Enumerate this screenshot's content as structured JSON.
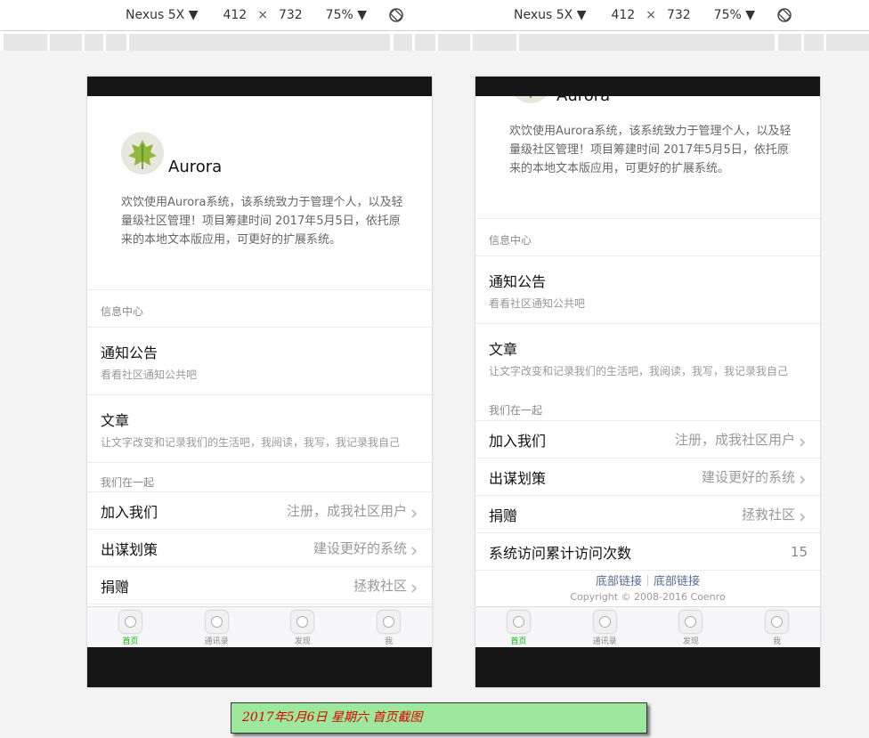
{
  "devtools": {
    "left": {
      "device": "Nexus 5X ▼",
      "width": "412",
      "times": "×",
      "height": "732",
      "zoom": "75% ▼"
    },
    "right": {
      "device": "Nexus 5X ▼",
      "width": "412",
      "times": "×",
      "height": "732",
      "zoom": "75% ▼"
    }
  },
  "app": {
    "name": "Aurora",
    "intro": "欢饮使用Aurora系统，该系统致力于管理个人，以及轻量级社区管理！项目筹建时间 2017年5月5日，依托原来的本地文本版应用，可更好的扩展系统。",
    "section1_title": "信息中心",
    "news": [
      {
        "title": "通知公告",
        "desc": "看看社区通知公共吧"
      },
      {
        "title": "文章",
        "desc": "让文字改变和记录我们的生活吧，我阅读，我写，我记录我自己"
      }
    ],
    "section2_title": "我们在一起",
    "cells": [
      {
        "label": "加入我们",
        "value": "注册，成我社区用户"
      },
      {
        "label": "出谋划策",
        "value": "建设更好的系统"
      },
      {
        "label": "捐赠",
        "value": "拯救社区"
      }
    ],
    "visits": {
      "label": "系统访问累计访问次数",
      "value": "15"
    },
    "footer": {
      "link1": "底部链接",
      "link2": "底部链接",
      "copyright": "Copyright © 2008-2016 Coenro"
    },
    "tabs": [
      {
        "label": "首页",
        "active": true
      },
      {
        "label": "通讯录"
      },
      {
        "label": "发现"
      },
      {
        "label": "我"
      }
    ],
    "active_color": "#09bb07"
  },
  "caption": "2017年5月6日 星期六    首页截图"
}
